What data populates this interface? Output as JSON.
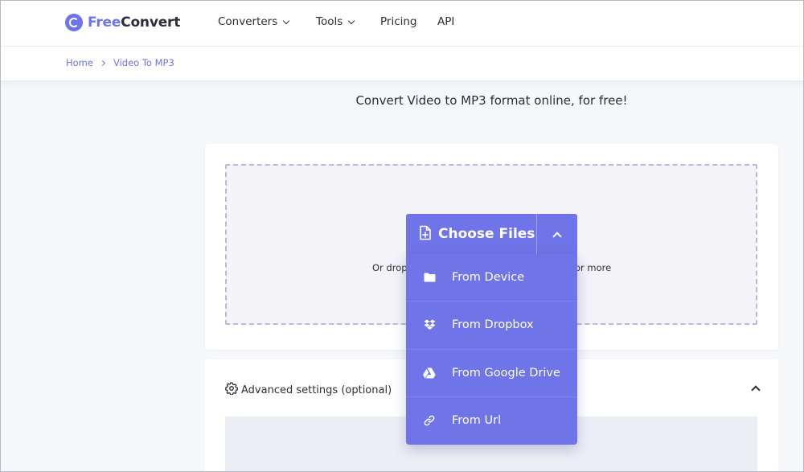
{
  "brand": {
    "free": "Free",
    "convert": "Convert",
    "accent": "#6f74e8"
  },
  "nav": {
    "items": [
      {
        "label": "Converters",
        "dropdown": true
      },
      {
        "label": "Tools",
        "dropdown": true
      },
      {
        "label": "Pricing",
        "dropdown": false
      },
      {
        "label": "API",
        "dropdown": false
      }
    ]
  },
  "breadcrumb": {
    "home": "Home",
    "current": "Video To MP3"
  },
  "subtitle": "Convert Video to MP3 format online, for free!",
  "upload": {
    "choose_label": "Choose Files",
    "hint_left": "Or drop",
    "hint_right": "or more",
    "menu": [
      {
        "label": "From Device",
        "icon": "folder-icon"
      },
      {
        "label": "From Dropbox",
        "icon": "dropbox-icon"
      },
      {
        "label": "From Google Drive",
        "icon": "google-drive-icon"
      },
      {
        "label": "From Url",
        "icon": "link-icon"
      }
    ]
  },
  "advanced": {
    "title": "Advanced settings (optional)"
  }
}
